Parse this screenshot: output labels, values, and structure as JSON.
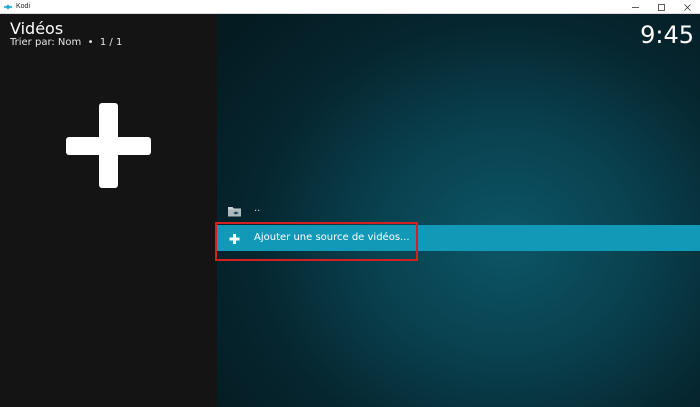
{
  "window": {
    "title": "Kodi",
    "icons": {
      "app": "kodi-logo-icon",
      "minimize": "minimize-icon",
      "maximize": "maximize-icon",
      "close": "close-icon"
    }
  },
  "header": {
    "title": "Vidéos",
    "sort": "Trier par: Nom  •  1 / 1",
    "clock": "9:45"
  },
  "preview": {
    "icon": "plus-icon"
  },
  "list": {
    "items": [
      {
        "label": "..",
        "icon": "folder-back-icon"
      },
      {
        "label": "Ajouter une source de vidéos...",
        "icon": "plus-icon"
      }
    ]
  },
  "colors": {
    "accent": "#1399b8",
    "highlight": "#d42020",
    "left_panel": "#141414",
    "background": "#09404e"
  }
}
